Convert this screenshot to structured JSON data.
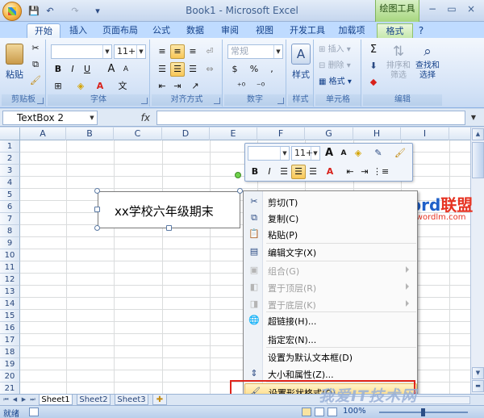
{
  "window": {
    "title": "Book1 - Microsoft Excel",
    "context_tab": "绘图工具",
    "help": "?",
    "minimize": "−",
    "restore": "▭",
    "close": "×"
  },
  "qat": {
    "save": "💾",
    "undo": "↶",
    "redo": "↷",
    "customize": "▾"
  },
  "tabs": [
    "开始",
    "插入",
    "页面布局",
    "公式",
    "数据",
    "审阅",
    "视图",
    "开发工具",
    "加载项",
    "格式"
  ],
  "ribbon": {
    "clipboard": {
      "label": "剪贴板",
      "paste": "粘贴"
    },
    "font": {
      "label": "字体",
      "size": "11+",
      "bold": "B",
      "italic": "I",
      "underline": "U",
      "grow": "A",
      "shrink": "A",
      "wen": "文"
    },
    "alignment": {
      "label": "对齐方式"
    },
    "number": {
      "label": "数字",
      "format": "常规",
      "percent": "%",
      "comma": ",",
      "currency": "$"
    },
    "styles": {
      "label": "样式",
      "button": "样式"
    },
    "cells": {
      "label": "单元格",
      "insert": "插入",
      "delete": "删除",
      "format": "格式"
    },
    "editing": {
      "label": "编辑",
      "sum": "Σ",
      "sort_filter": "排序和\n筛选",
      "find_select": "查找和\n选择",
      "sort1": "排序和",
      "sort2": "筛选",
      "find1": "查找和",
      "find2": "选择"
    }
  },
  "formula_bar": {
    "name_box": "TextBox 2",
    "fx": "fx"
  },
  "columns": [
    "A",
    "B",
    "C",
    "D",
    "E",
    "F",
    "G",
    "H",
    "I"
  ],
  "rows": [
    "1",
    "2",
    "3",
    "4",
    "5",
    "6",
    "7",
    "8",
    "9",
    "10",
    "11",
    "12",
    "13",
    "14",
    "15",
    "16",
    "17",
    "18",
    "19",
    "20",
    "21",
    "22"
  ],
  "shape": {
    "text": "xx学校六年级期末"
  },
  "mini_toolbar": {
    "size": "11+",
    "bold": "B",
    "italic": "I"
  },
  "context_menu": {
    "items": [
      {
        "label": "剪切(T)",
        "icon": "scissors-icon",
        "glyph": "✂",
        "enabled": true
      },
      {
        "label": "复制(C)",
        "icon": "copy-icon",
        "glyph": "⧉",
        "enabled": true
      },
      {
        "label": "粘贴(P)",
        "icon": "paste-icon",
        "glyph": "📋",
        "enabled": true
      },
      {
        "label": "编辑文字(X)",
        "icon": "edit-text-icon",
        "glyph": "▤",
        "enabled": true
      },
      {
        "label": "组合(G)",
        "icon": "group-icon",
        "glyph": "▣",
        "enabled": false,
        "submenu": true
      },
      {
        "label": "置于顶层(R)",
        "icon": "bring-front-icon",
        "glyph": "◧",
        "enabled": false,
        "submenu": true
      },
      {
        "label": "置于底层(K)",
        "icon": "send-back-icon",
        "glyph": "◨",
        "enabled": false,
        "submenu": true
      },
      {
        "label": "超链接(H)...",
        "icon": "hyperlink-icon",
        "glyph": "🌐",
        "enabled": true
      },
      {
        "label": "指定宏(N)...",
        "icon": "",
        "glyph": "",
        "enabled": true
      },
      {
        "label": "设置为默认文本框(D)",
        "icon": "",
        "glyph": "",
        "enabled": true
      },
      {
        "label": "大小和属性(Z)...",
        "icon": "size-properties-icon",
        "glyph": "⇕",
        "enabled": true
      },
      {
        "label": "设置形状格式(O)...",
        "icon": "format-shape-icon",
        "glyph": "🖌",
        "enabled": true,
        "highlighted": true
      }
    ]
  },
  "sheets": [
    "Sheet1",
    "Sheet2",
    "Sheet3"
  ],
  "status": {
    "ready": "就绪",
    "zoom": "100%"
  },
  "watermarks": {
    "word": "Word",
    "lianmeng": "联盟",
    "url": "www.wordlm.com",
    "bottom": "我爱IT技术网"
  },
  "colors": {
    "accent": "#15428b",
    "highlight": "#ffd87a",
    "red_box": "#e0251c"
  }
}
